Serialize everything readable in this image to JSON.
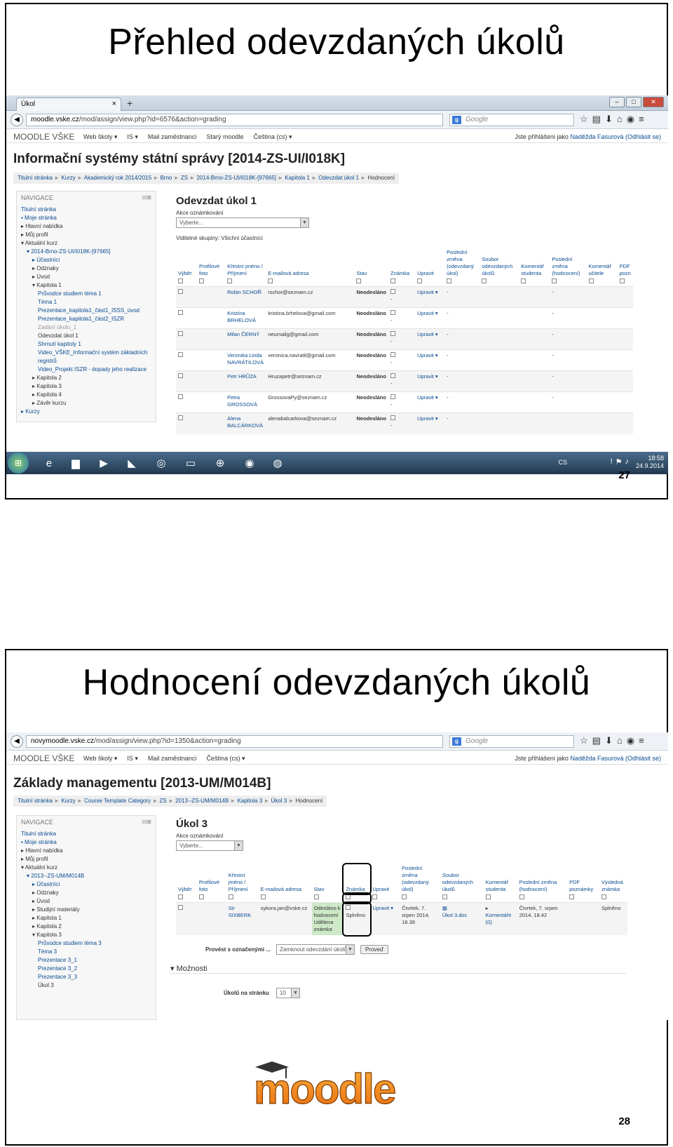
{
  "slide1": {
    "title": "Přehled odevzdaných úkolů",
    "page_number": "27",
    "browser": {
      "tab_title": "Úkol",
      "tab_close": "×",
      "new_tab": "+",
      "url_host": "moodle.vske.cz",
      "url_path": "/mod/assign/view.php?id=6576&action=grading",
      "search_engine": "Google",
      "search_placeholder": "Google"
    },
    "moodle": {
      "brand": "MOODLE VŠKE",
      "menu": [
        "Web školy ▾",
        "IS ▾",
        "Mail zaměstnanci",
        "Starý moodle",
        "Čeština (cs) ▾"
      ],
      "login_text": "Jste přihlášeni jako ",
      "login_user": "Naděžda Fasurová (Odhlásit se)",
      "course_title": "Informační systémy státní správy [2014-ZS-UI/I018K]",
      "breadcrumb": [
        "Titulní stránka",
        "Kurzy",
        "Akademický rok 2014/2015",
        "Brno",
        "ZS",
        "2014-Brno-ZS-UI/I018K-[97665]",
        "Kapitola 1",
        "Odevzdat úkol 1",
        "Hodnocení"
      ]
    },
    "nav": {
      "header": "NAVIGACE",
      "items": [
        {
          "label": "Titulní stránka",
          "indent": 0,
          "style": "link"
        },
        {
          "label": "▪ Moje stránka",
          "indent": 0,
          "style": "link"
        },
        {
          "label": "▸ Hlavní nabídka",
          "indent": 0,
          "style": "dark"
        },
        {
          "label": "▸ Můj profil",
          "indent": 0,
          "style": "dark"
        },
        {
          "label": "▾ Aktuální kurz",
          "indent": 0,
          "style": "dark"
        },
        {
          "label": "▾ 2014-Brno-ZS-UI/I018K-[97665]",
          "indent": 1,
          "style": "link"
        },
        {
          "label": "▸ Účastníci",
          "indent": 2,
          "style": "link"
        },
        {
          "label": "▸ Odznaky",
          "indent": 2,
          "style": "dark"
        },
        {
          "label": "▸ Úvod",
          "indent": 2,
          "style": "dark"
        },
        {
          "label": "▾ Kapitola 1",
          "indent": 2,
          "style": "dark"
        },
        {
          "label": "Průvodce studiem téma 1",
          "indent": 3,
          "style": "link"
        },
        {
          "label": "Téma 1",
          "indent": 3,
          "style": "link"
        },
        {
          "label": "Prezentace_kapitola1_část1_ISSS_úvod",
          "indent": 3,
          "style": "link"
        },
        {
          "label": "Prezentace_kapitola1_část2_ISZR",
          "indent": 3,
          "style": "link"
        },
        {
          "label": "Zadání úkolu_1",
          "indent": 3,
          "style": "dim"
        },
        {
          "label": "Odevzdat úkol 1",
          "indent": 3,
          "style": "dark"
        },
        {
          "label": "Shrnutí kapitoly 1",
          "indent": 3,
          "style": "link"
        },
        {
          "label": "Video_VŠKE_Informační systém základních",
          "indent": 3,
          "style": "link"
        },
        {
          "label": "registrů",
          "indent": 3,
          "style": "link"
        },
        {
          "label": "Video_Projekt ISZR - dopady jeho realizace",
          "indent": 3,
          "style": "link"
        },
        {
          "label": "▸ Kapitola 2",
          "indent": 2,
          "style": "dark"
        },
        {
          "label": "▸ Kapitola 3",
          "indent": 2,
          "style": "dark"
        },
        {
          "label": "▸ Kapitola 4",
          "indent": 2,
          "style": "dark"
        },
        {
          "label": "▸ Závěr kurzu",
          "indent": 2,
          "style": "dark"
        },
        {
          "label": "▸ Kurzy",
          "indent": 0,
          "style": "link"
        }
      ]
    },
    "content": {
      "heading": "Odevzdat úkol 1",
      "actions_label": "Akce oznámkování",
      "select_value": "Vyberte...",
      "groups_label": "Viditelné skupiny: Všichni účastníci",
      "columns": [
        "Výběr",
        "Profilové foto",
        "Křestní jméno / Příjmení",
        "E-mailová adresa",
        "Stav",
        "Známka",
        "Upravit",
        "Poslední změna (odevzdaný úkol)",
        "Soubor odevzdaných úkolů",
        "Komentář studenta",
        "Poslední změna (hodnocení)",
        "Komentář učitele",
        "PDF pozn"
      ],
      "rows": [
        {
          "name": "Robin SCHOŘ",
          "email": "rschor@seznam.cz",
          "status": "Neodesláno",
          "grade": "-",
          "edit": "Upravit ▾",
          "last": "-",
          "last_grade": "-"
        },
        {
          "name": "Kristína BRHELOVÁ",
          "email": "kristina.brhelova@gmail.com",
          "status": "Neodesláno",
          "grade": "-",
          "edit": "Upravit ▾",
          "last": "-",
          "last_grade": "-"
        },
        {
          "name": "Milan ČERNÝ",
          "email": "neumailg@gmail.com",
          "status": "Neodesláno",
          "grade": "-",
          "edit": "Upravit ▾",
          "last": "-",
          "last_grade": "-"
        },
        {
          "name": "Veronika Linda NAVRÁTILOVÁ",
          "email": "veronica.navratil@gmail.com",
          "status": "Neodesláno",
          "grade": "-",
          "edit": "Upravit ▾",
          "last": "-",
          "last_grade": "-"
        },
        {
          "name": "Petr HRŮZA",
          "email": "Hruzapetr@seznam.cz",
          "status": "Neodesláno",
          "grade": "-",
          "edit": "Upravit ▾",
          "last": "-",
          "last_grade": "-"
        },
        {
          "name": "Petra GROSSOVÁ",
          "email": "GrossovaPy@seznam.cz",
          "status": "Neodesláno",
          "grade": "-",
          "edit": "Upravit ▾",
          "last": "-",
          "last_grade": "-"
        },
        {
          "name": "Alena BALCÁRKOVÁ",
          "email": "alenabalcarkova@seznam.cz",
          "status": "Neodesláno",
          "grade": "-",
          "edit": "Upravit ▾",
          "last": "-",
          "last_grade": ""
        }
      ]
    },
    "taskbar": {
      "lang": "CS",
      "time": "18:58",
      "date": "24.9.2014"
    }
  },
  "slide2": {
    "title": "Hodnocení odevzdaných úkolů",
    "page_number": "28",
    "browser": {
      "url_host": "novymoodle.vske.cz",
      "url_path": "/mod/assign/view.php?id=1350&action=grading",
      "search_placeholder": "Google"
    },
    "moodle": {
      "brand": "MOODLE VŠKE",
      "menu": [
        "Web školy ▾",
        "IS ▾",
        "Mail zaměstnanci",
        "Čeština (cs) ▾"
      ],
      "login_text": "Jste přihlášeni jako ",
      "login_user": "Naděžda Fasurová (Odhlásit se)",
      "course_title": "Základy managementu [2013-UM/M014B]",
      "breadcrumb": [
        "Titulní stránka",
        "Kurzy",
        "Course Template Category",
        "ZS",
        "2013--ZS-UM/M014B",
        "Kapitola 3",
        "Úkol 3",
        "Hodnocení"
      ]
    },
    "nav": {
      "header": "NAVIGACE",
      "items": [
        {
          "label": "Titulní stránka",
          "indent": 0,
          "style": "link"
        },
        {
          "label": "▪ Moje stránka",
          "indent": 0,
          "style": "link"
        },
        {
          "label": "▸ Hlavní nabídka",
          "indent": 0,
          "style": "dark"
        },
        {
          "label": "▸ Můj profil",
          "indent": 0,
          "style": "dark"
        },
        {
          "label": "▾ Aktuální kurz",
          "indent": 0,
          "style": "dark"
        },
        {
          "label": "▾ 2013--ZS-UM/M014B",
          "indent": 1,
          "style": "link"
        },
        {
          "label": "▸ Účastníci",
          "indent": 2,
          "style": "link"
        },
        {
          "label": "▸ Odznaky",
          "indent": 2,
          "style": "dark"
        },
        {
          "label": "▸ Úvod",
          "indent": 2,
          "style": "dark"
        },
        {
          "label": "▸ Studijní materiály",
          "indent": 2,
          "style": "dark"
        },
        {
          "label": "▸ Kapitola 1",
          "indent": 2,
          "style": "dark"
        },
        {
          "label": "▸ Kapitola 2",
          "indent": 2,
          "style": "dark"
        },
        {
          "label": "▾ Kapitola 3",
          "indent": 2,
          "style": "dark"
        },
        {
          "label": "Průvodce studiem téma 3",
          "indent": 3,
          "style": "link"
        },
        {
          "label": "Téma 3",
          "indent": 3,
          "style": "link"
        },
        {
          "label": "Prezentace 3_1",
          "indent": 3,
          "style": "link"
        },
        {
          "label": "Prezentace 3_2",
          "indent": 3,
          "style": "link"
        },
        {
          "label": "Prezentace 3_3",
          "indent": 3,
          "style": "link"
        },
        {
          "label": "Úkol 3",
          "indent": 3,
          "style": "dark"
        }
      ]
    },
    "content": {
      "heading": "Úkol 3",
      "actions_label": "Akce oznámkování",
      "select_value": "Vyberte...",
      "columns": [
        "Výběr",
        "Profilové foto",
        "Křestní jméno / Příjmení",
        "E-mailová adresa",
        "Stav",
        "Známka",
        "Upravit",
        "Poslední změna (odevzdaný úkol)",
        "Soubor odevzdaných úkolů",
        "Komentář studenta",
        "Poslední změna (hodnocení)",
        "PDF poznámky",
        "Výsledná známka"
      ],
      "row": {
        "name": "Sir SIXBERK",
        "email": "sykora.jan@vske.cz",
        "status": "Odesláno k hodnocení Udělena známka",
        "grade": "Splněno",
        "edit": "Upravit ▾",
        "last": "Čtvrtek, 7. srpen 2014, 18.39",
        "file": "Úkol 3.doc",
        "comment": "Komentáře (0)",
        "last_grade": "Čtvrtek, 7. srpen 2014, 18.42",
        "final": "Splněno"
      },
      "bulk_label": "Provést s označenými ...",
      "bulk_select": "Zamknout odevzdání úkolů",
      "bulk_button": "Proveď",
      "options_heading": "▾ Možnosti",
      "per_page_label": "Úkolů na stránku",
      "per_page_value": "10"
    },
    "logo_text": "moodle"
  },
  "colors": {
    "link": "#0a4c91",
    "green_status": "#cde9c8",
    "logo_orange": "#f7931e"
  }
}
